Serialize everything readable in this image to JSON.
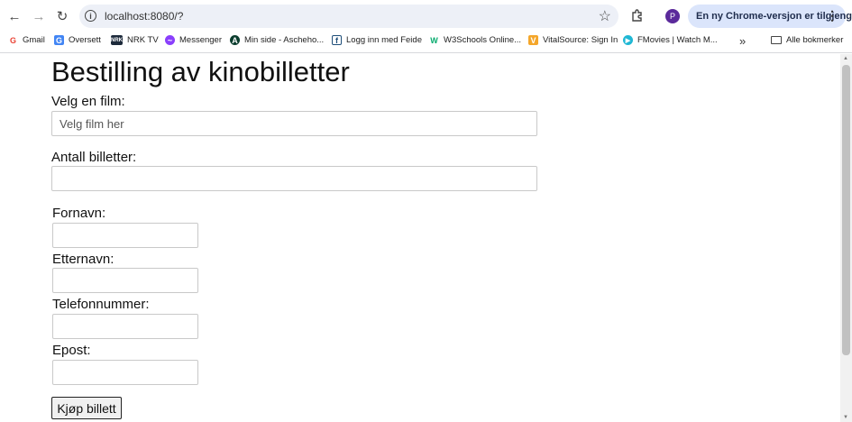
{
  "browser": {
    "url": "localhost:8080/?",
    "avatar_letter": "P",
    "update_label": "En ny Chrome-versjon er tilgjengelig",
    "bookmarks": [
      {
        "label": "Gmail",
        "icon": "gmail-icon"
      },
      {
        "label": "Oversett",
        "icon": "translate-icon"
      },
      {
        "label": "NRK TV",
        "icon": "nrk-icon"
      },
      {
        "label": "Messenger",
        "icon": "messenger-icon"
      },
      {
        "label": "Min side - Ascheho...",
        "icon": "aschehoug-icon"
      },
      {
        "label": "Logg inn med Feide",
        "icon": "feide-icon"
      },
      {
        "label": "W3Schools Online...",
        "icon": "w3schools-icon"
      },
      {
        "label": "VitalSource: Sign In",
        "icon": "vitalsource-icon"
      },
      {
        "label": "FMovies | Watch M...",
        "icon": "fmovies-icon"
      }
    ],
    "all_bookmarks_label": "Alle bokmerker"
  },
  "page": {
    "title": "Bestilling av kinobilletter",
    "film_label": "Velg en film:",
    "film_placeholder": "Velg film her",
    "tickets_label": "Antall billetter:",
    "firstname_label": "Fornavn:",
    "lastname_label": "Etternavn:",
    "phone_label": "Telefonnummer:",
    "email_label": "Epost:",
    "buy_button": "Kjøp billett"
  },
  "colors": {
    "update_pill_bg": "#dbe5fb",
    "avatar_bg": "#5b2a9b"
  }
}
